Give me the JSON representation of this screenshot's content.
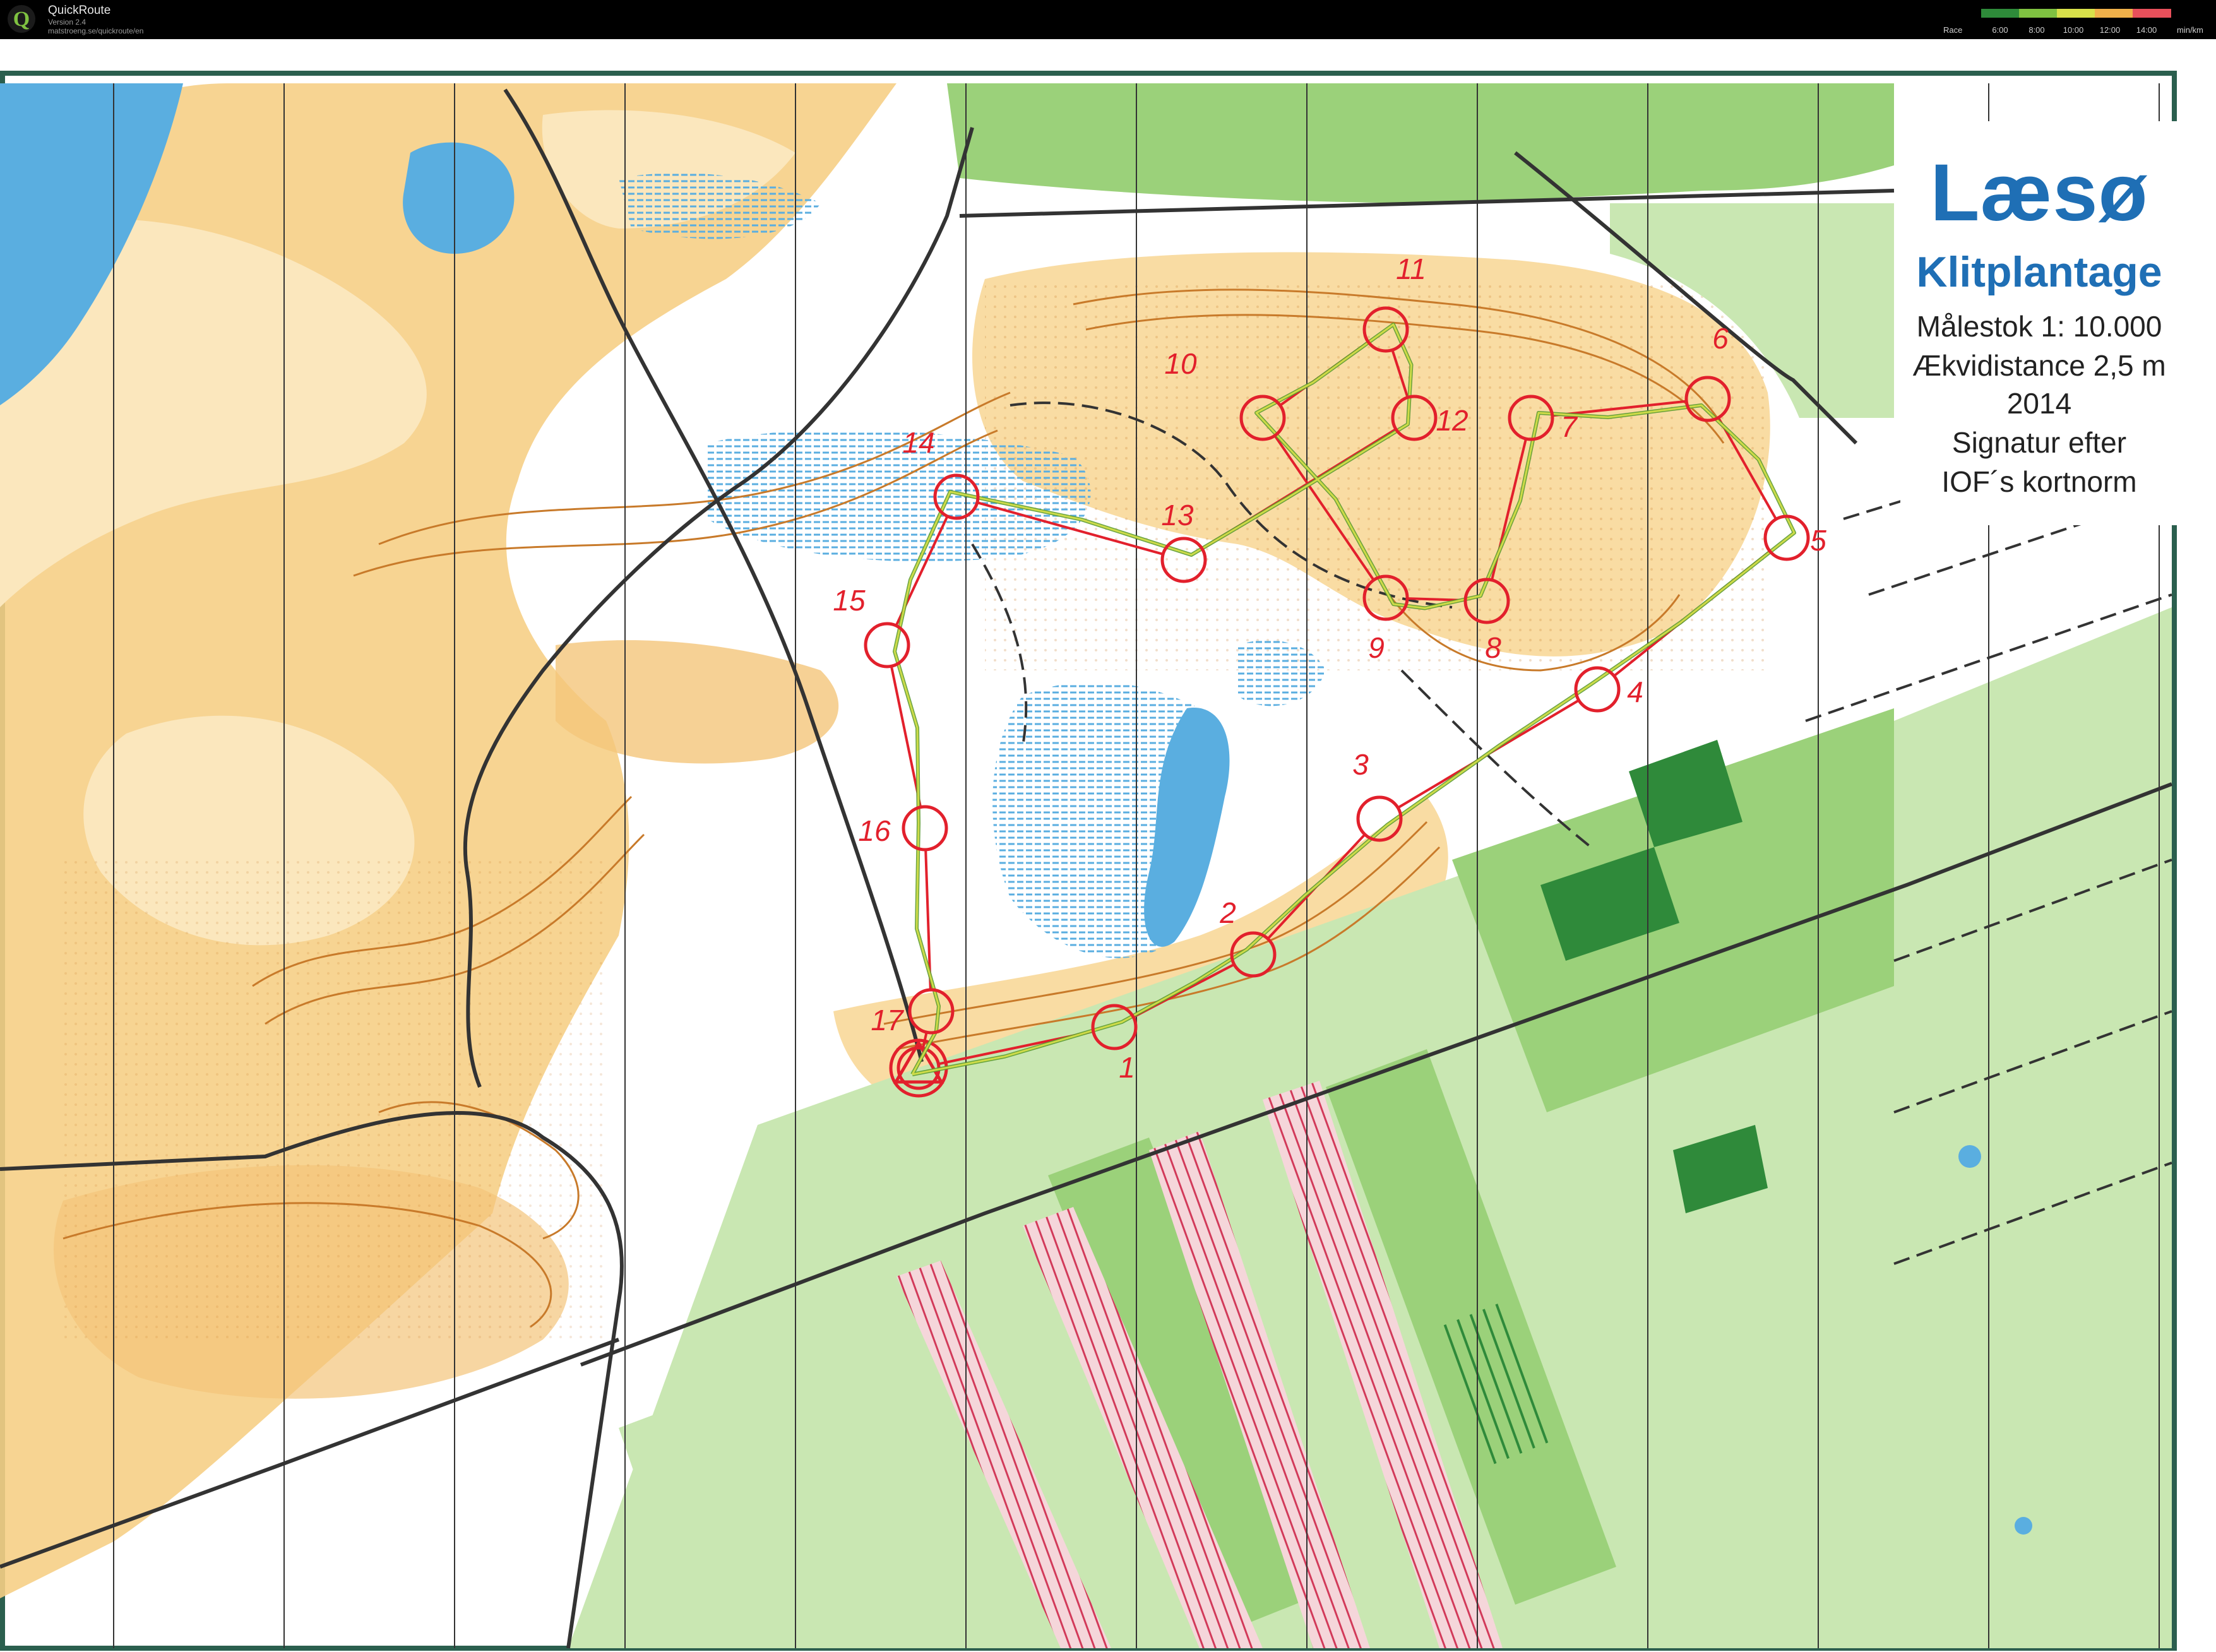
{
  "app": {
    "name": "QuickRoute",
    "version": "Version 2.4",
    "url": "matstroeng.se/quickroute/en"
  },
  "pace_legend": {
    "label": "Race",
    "ticks": [
      "6:00",
      "8:00",
      "10:00",
      "12:00",
      "14:00"
    ],
    "unit": "min/km",
    "colors": [
      "#2e8b3a",
      "#7fc241",
      "#d8e14a",
      "#f0b14a",
      "#e8505b"
    ]
  },
  "map": {
    "title": "Læsø",
    "subtitle": "Klitplantage",
    "scale": "Målestok 1: 10.000",
    "contour_interval": "Ækvidistance 2,5 m",
    "year": "2014",
    "symbol_line1": "Signatur efter",
    "symbol_line2": "IOF´s kortnorm"
  },
  "controls": [
    {
      "label": "1"
    },
    {
      "label": "2"
    },
    {
      "label": "3"
    },
    {
      "label": "4"
    },
    {
      "label": "5"
    },
    {
      "label": "6"
    },
    {
      "label": "7"
    },
    {
      "label": "8"
    },
    {
      "label": "9"
    },
    {
      "label": "10"
    },
    {
      "label": "11"
    },
    {
      "label": "12"
    },
    {
      "label": "13"
    },
    {
      "label": "14"
    },
    {
      "label": "15"
    },
    {
      "label": "16"
    },
    {
      "label": "17"
    }
  ],
  "colors": {
    "course": "#e2202c",
    "route": "#5a9a30",
    "water": "#5aaee0",
    "open_land": "#f6cf86",
    "rough_open": "#fbe7bd",
    "vegetation": "#9bd17a",
    "dense_vegetation": "#2f8a3a",
    "contour": "#c87a2a",
    "title_blue": "#1f6fb5"
  }
}
